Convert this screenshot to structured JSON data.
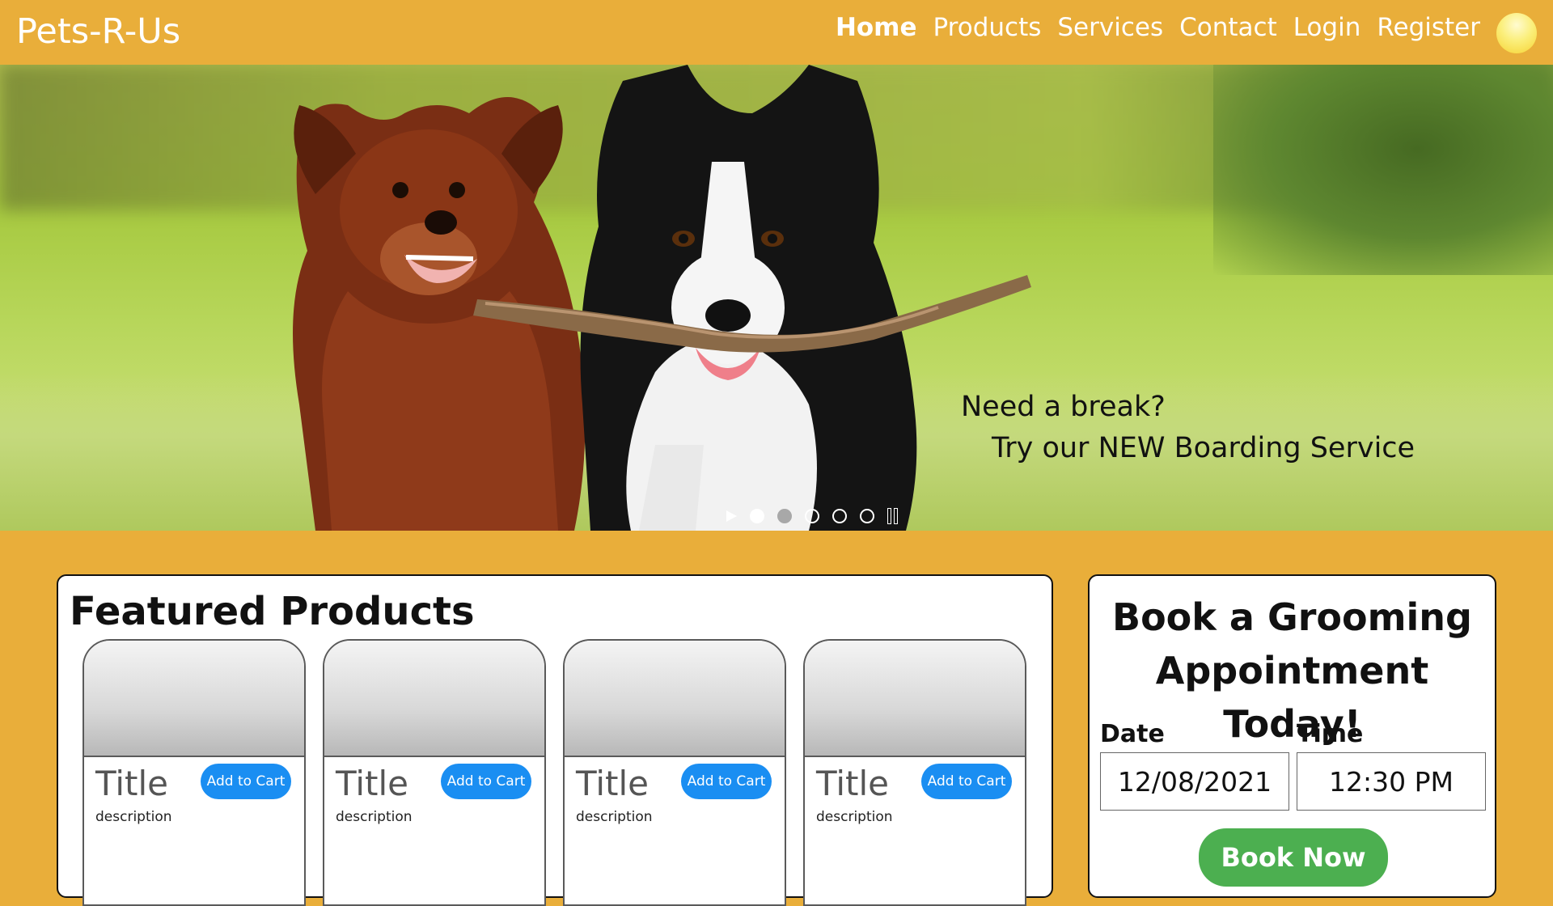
{
  "header": {
    "brand": "Pets-R-Us",
    "nav": [
      {
        "label": "Home",
        "active": true
      },
      {
        "label": "Products"
      },
      {
        "label": "Services"
      },
      {
        "label": "Contact"
      },
      {
        "label": "Login"
      },
      {
        "label": "Register"
      }
    ],
    "avatar_icon": "user-avatar-icon"
  },
  "hero": {
    "line1": "Need a break?",
    "line2": "Try our NEW Boarding Service",
    "slides": 5,
    "current_slide": 1
  },
  "featured": {
    "heading": "Featured Products",
    "products": [
      {
        "title": "Title",
        "description": "description",
        "button": "Add to Cart"
      },
      {
        "title": "Title",
        "description": "description",
        "button": "Add to Cart"
      },
      {
        "title": "Title",
        "description": "description",
        "button": "Add to Cart"
      },
      {
        "title": "Title",
        "description": "description",
        "button": "Add to Cart"
      }
    ]
  },
  "booking": {
    "heading_line1": "Book a Grooming",
    "heading_line2": "Appointment Today!",
    "date_label": "Date",
    "date_value": "12/08/2021",
    "time_label": "Time",
    "time_value": "12:30 PM",
    "button": "Book Now"
  },
  "colors": {
    "brand": "#e9ae3a",
    "cart_button": "#1a8ef2",
    "book_button": "#4caf50"
  }
}
